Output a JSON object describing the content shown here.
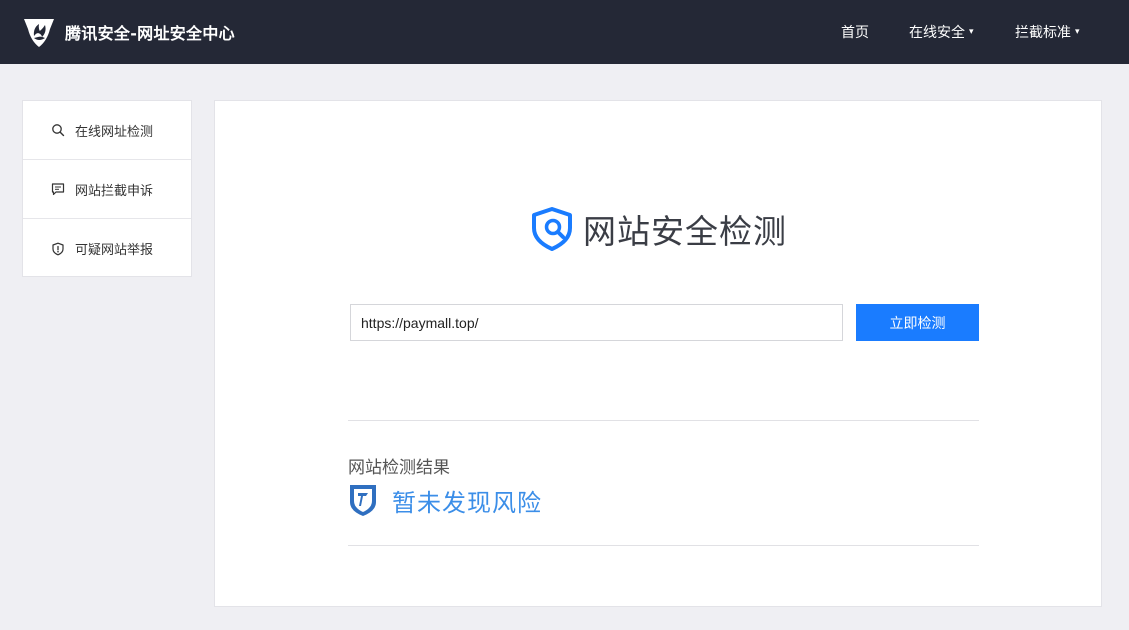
{
  "header": {
    "brand_title": "腾讯安全-网址安全中心",
    "nav": [
      {
        "label": "首页",
        "has_dropdown": false
      },
      {
        "label": "在线安全",
        "has_dropdown": true
      },
      {
        "label": "拦截标准",
        "has_dropdown": true
      }
    ],
    "dropdown_caret": "▾"
  },
  "sidebar": {
    "items": [
      {
        "label": "在线网址检测",
        "icon": "search-icon"
      },
      {
        "label": "网站拦截申诉",
        "icon": "message-icon"
      },
      {
        "label": "可疑网站举报",
        "icon": "shield-alert-icon"
      }
    ]
  },
  "main": {
    "title": "网站安全检测",
    "url_value": "https://paymall.top/",
    "button_label": "立即检测",
    "result_label": "网站检测结果",
    "result_text": "暂未发现风险"
  },
  "colors": {
    "header_bg": "#242836",
    "page_bg": "#efeff3",
    "accent_blue": "#1a7cff",
    "result_blue": "#3b8ee8"
  }
}
